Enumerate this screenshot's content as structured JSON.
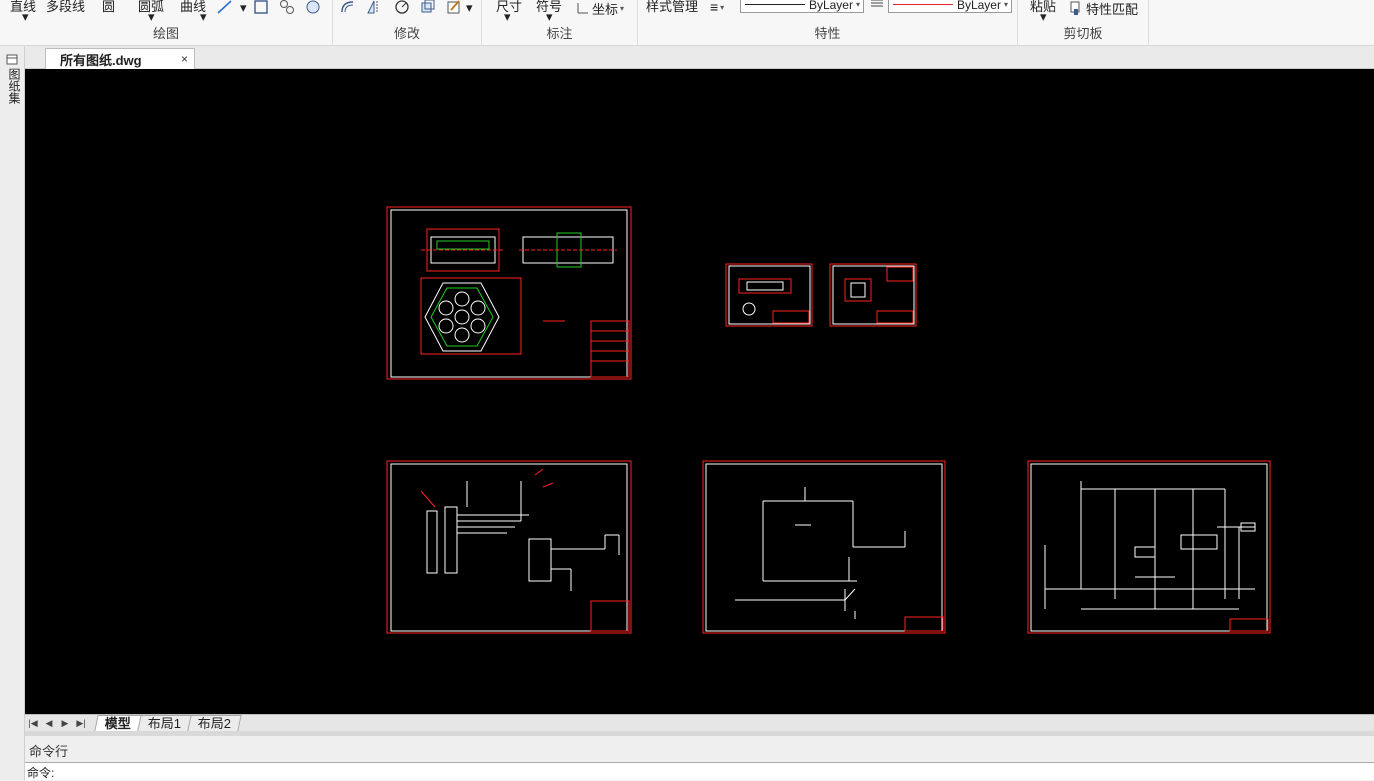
{
  "ribbon": {
    "draw": {
      "title": "绘图",
      "tools": [
        "直线",
        "多段线",
        "圆",
        "圆弧",
        "曲线"
      ]
    },
    "modify": {
      "title": "修改"
    },
    "annotate": {
      "title": "标注",
      "tools": [
        "尺寸",
        "符号",
        "坐标"
      ]
    },
    "properties": {
      "title": "特性",
      "style_manager": "样式管理",
      "linetype": "ByLayer",
      "color": "ByLayer"
    },
    "clipboard": {
      "title": "剪切板",
      "paste": "粘贴",
      "match": "特性匹配"
    }
  },
  "document_tab": {
    "name": "所有图纸.dwg",
    "close": "×"
  },
  "left_palette": {
    "label": "图纸集"
  },
  "layout_tabs": [
    "模型",
    "布局1",
    "布局2"
  ],
  "command": {
    "header": "命令行",
    "prompt": "命令:"
  },
  "colors": {
    "canvas": "#000000",
    "frame": "#ff2222",
    "drawing": "#ffffff",
    "green": "#22cc22"
  }
}
